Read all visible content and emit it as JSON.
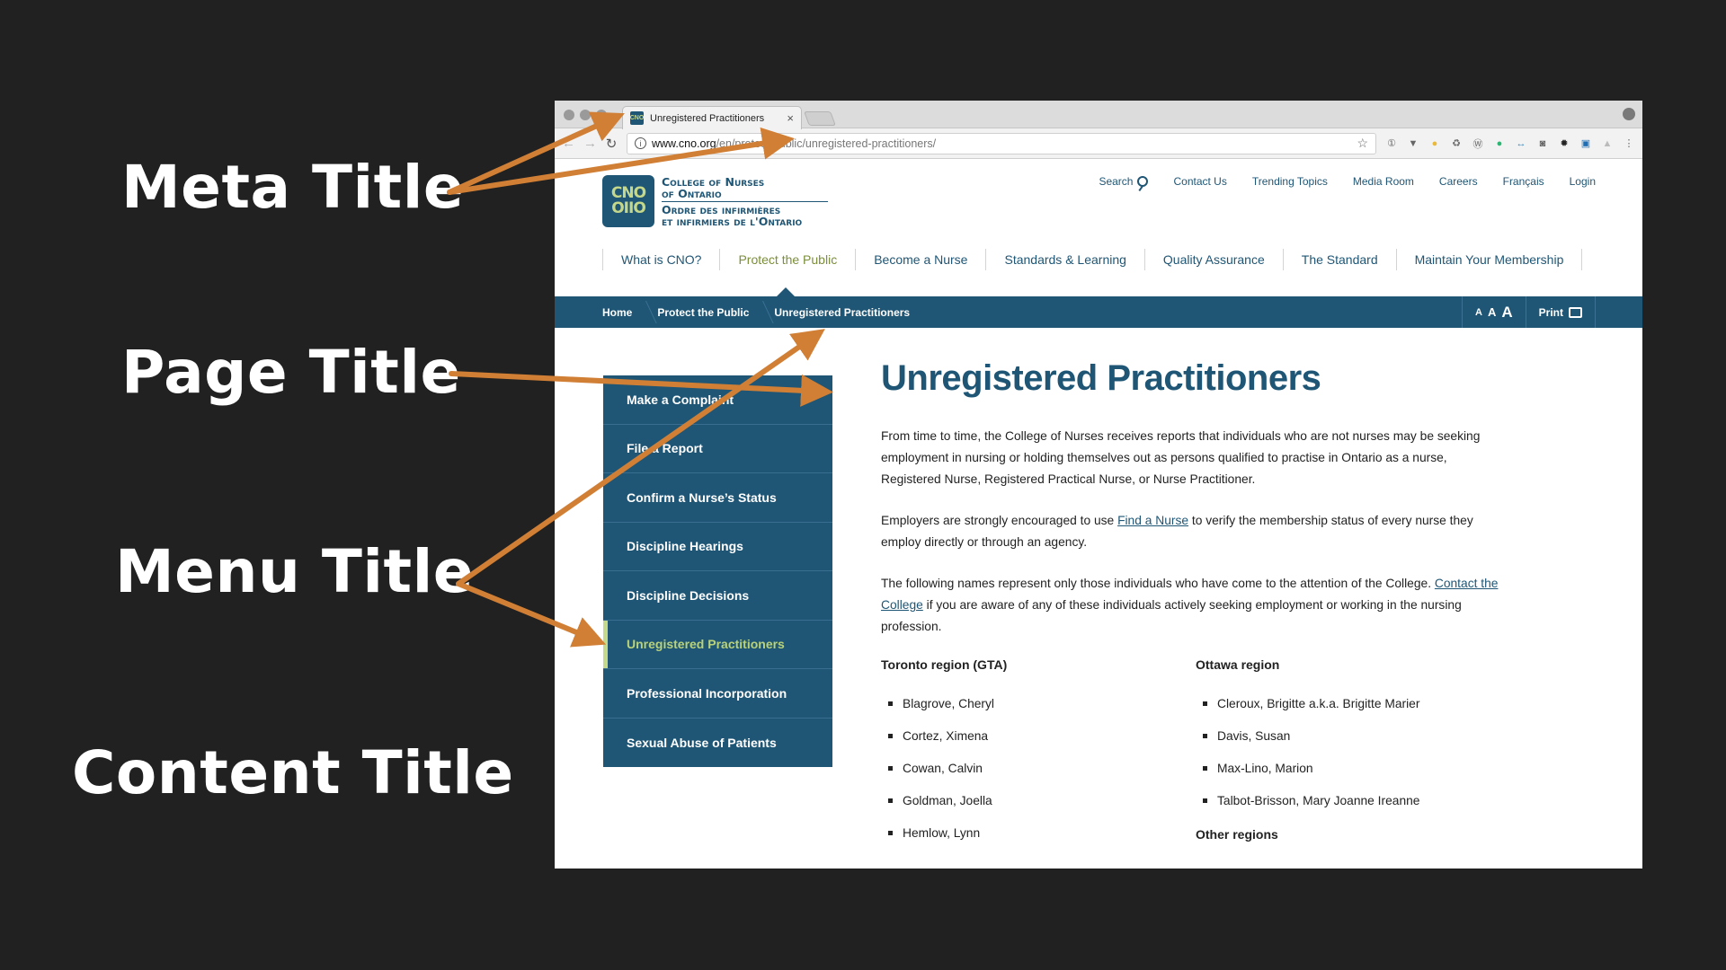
{
  "annotations": {
    "meta_title": "Meta Title",
    "page_title": "Page Title",
    "menu_title": "Menu Title",
    "content_title": "Content Title",
    "arrow_color": "#d17f35"
  },
  "browser": {
    "tab_title": "Unregistered Practitioners",
    "tab_close": "×",
    "url_host": "www.cno.org",
    "url_path": "/en/protect-public/unregistered-practitioners/",
    "extension_icons": [
      "1password-icon",
      "pocket-icon",
      "lightbulb-icon",
      "recycle-icon",
      "wordpress-icon",
      "grammarly-icon",
      "arrows-icon",
      "camera-icon",
      "gear-icon",
      "linkedin-icon",
      "drive-icon",
      "more-icon"
    ]
  },
  "site": {
    "logo": {
      "mark_top": "CNO",
      "mark_bottom": "OIIO",
      "line1": "College of Nurses",
      "line2": "of Ontario",
      "line3": "Ordre des infirmières",
      "line4": "et infirmiers de l'Ontario"
    },
    "top_links": [
      "Search",
      "Contact Us",
      "Trending Topics",
      "Media Room",
      "Careers",
      "Français",
      "Login"
    ],
    "main_nav": [
      {
        "label": "What is CNO?",
        "active": false
      },
      {
        "label": "Protect the Public",
        "active": true
      },
      {
        "label": "Become a Nurse",
        "active": false
      },
      {
        "label": "Standards & Learning",
        "active": false
      },
      {
        "label": "Quality Assurance",
        "active": false
      },
      {
        "label": "The Standard",
        "active": false
      },
      {
        "label": "Maintain Your Membership",
        "active": false
      }
    ],
    "breadcrumb": [
      "Home",
      "Protect the Public",
      "Unregistered Practitioners"
    ],
    "text_size": [
      "A",
      "A",
      "A"
    ],
    "print_label": "Print",
    "sidebar": [
      {
        "label": "Make a Complaint",
        "active": false
      },
      {
        "label": "File a Report",
        "active": false
      },
      {
        "label": "Confirm a Nurse’s Status",
        "active": false
      },
      {
        "label": "Discipline Hearings",
        "active": false
      },
      {
        "label": "Discipline Decisions",
        "active": false
      },
      {
        "label": "Unregistered Practitioners",
        "active": true
      },
      {
        "label": "Professional Incorporation",
        "active": false
      },
      {
        "label": "Sexual Abuse of Patients",
        "active": false
      }
    ],
    "content": {
      "heading": "Unregistered Practitioners",
      "p1": "From time to time, the College of Nurses receives reports that individuals who are not nurses may be seeking employment in nursing or holding themselves out as persons qualified to practise in Ontario as a nurse, Registered Nurse, Registered Practical Nurse, or Nurse Practitioner.",
      "p2_before": "Employers are strongly encouraged to use ",
      "p2_link": "Find a Nurse",
      "p2_after": " to verify the membership status of every nurse they employ directly or through an agency.",
      "p3_before": "The following names represent only those individuals who have come to the attention of the College. ",
      "p3_link": "Contact the College",
      "p3_after": " if you are aware of any of these individuals actively seeking employment or working in the nursing profession.",
      "toronto": {
        "title": "Toronto region (GTA)",
        "names": [
          "Blagrove, Cheryl",
          "Cortez, Ximena",
          "Cowan, Calvin",
          "Goldman, Joella",
          "Hemlow, Lynn"
        ]
      },
      "ottawa": {
        "title": "Ottawa region",
        "names": [
          "Cleroux, Brigitte a.k.a. Brigitte Marier",
          "Davis, Susan",
          "Max-Lino, Marion",
          "Talbot-Brisson, Mary Joanne Ireanne"
        ]
      },
      "other_title": "Other regions"
    },
    "colors": {
      "brand_blue": "#1f5675",
      "active_green": "#7b8f3a",
      "sidebar_active": "#b9d27a"
    }
  }
}
